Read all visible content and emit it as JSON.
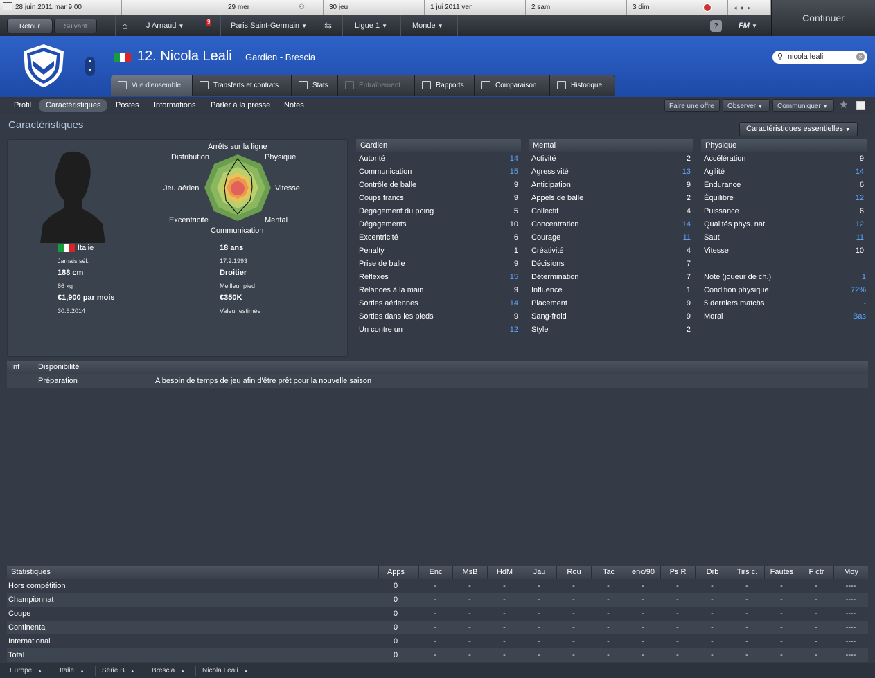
{
  "datebar": {
    "items": [
      {
        "label": "28 juin 2011 mar 9:00"
      },
      {
        "label": "29  mer"
      },
      {
        "label": "30  jeu"
      },
      {
        "label": "1 jui 2011 ven"
      },
      {
        "label": "2  sam"
      },
      {
        "label": "3  dim"
      }
    ]
  },
  "nav": {
    "back": "Retour",
    "forward": "Suivant",
    "manager": "J Arnaud",
    "inbox_count": "9",
    "club": "Paris Saint-Germain",
    "league": "Ligue 1",
    "world": "Monde",
    "help": "?",
    "fm": "FM",
    "continue": "Continuer"
  },
  "player": {
    "number_name": "12. Nicola Leali",
    "position": "Gardien - Brescia",
    "search_value": "nicola leali"
  },
  "tabs": [
    {
      "label": "Vue d'ensemble"
    },
    {
      "label": "Transferts et contrats"
    },
    {
      "label": "Stats"
    },
    {
      "label": "Entraînement"
    },
    {
      "label": "Rapports"
    },
    {
      "label": "Comparaison"
    },
    {
      "label": "Historique"
    }
  ],
  "subtabs": [
    {
      "label": "Profil"
    },
    {
      "label": "Caractéristiques"
    },
    {
      "label": "Postes"
    },
    {
      "label": "Informations"
    },
    {
      "label": "Parler à la presse"
    },
    {
      "label": "Notes"
    }
  ],
  "actions": {
    "offer": "Faire une offre",
    "watch": "Observer",
    "talk": "Communiquer"
  },
  "section": {
    "title": "Caractéristiques",
    "dropdown": "Caractéristiques essentielles"
  },
  "radar": {
    "labels": {
      "top": "Arrêts sur la ligne",
      "tl": "Distribution",
      "tr": "Physique",
      "l": "Jeu aérien",
      "r": "Vitesse",
      "bl": "Excentricité",
      "br": "Mental",
      "b": "Communication"
    }
  },
  "info": {
    "nation": "Italie",
    "caps": "Jamais sél.",
    "height": "188 cm",
    "weight": "86 kg",
    "wage": "€1,900 par mois",
    "contract_end": "30.6.2014",
    "age": "18 ans",
    "dob": "17.2.1993",
    "foot": "Droitier",
    "foot_label": "Meilleur pied",
    "value": "€350K",
    "value_label": "Valeur estimée"
  },
  "gk": {
    "title": "Gardien",
    "rows": [
      {
        "name": "Autorité",
        "value": "14",
        "hl": true
      },
      {
        "name": "Communication",
        "value": "15",
        "hl": true
      },
      {
        "name": "Contrôle de balle",
        "value": "9"
      },
      {
        "name": "Coups francs",
        "value": "9"
      },
      {
        "name": "Dégagement du poing",
        "value": "5"
      },
      {
        "name": "Dégagements",
        "value": "10"
      },
      {
        "name": "Excentricité",
        "value": "6"
      },
      {
        "name": "Penalty",
        "value": "1"
      },
      {
        "name": "Prise de balle",
        "value": "9"
      },
      {
        "name": "Réflexes",
        "value": "15",
        "hl": true
      },
      {
        "name": "Relances à la main",
        "value": "9"
      },
      {
        "name": "Sorties aériennes",
        "value": "14",
        "hl": true
      },
      {
        "name": "Sorties dans les pieds",
        "value": "9"
      },
      {
        "name": "Un contre un",
        "value": "12",
        "hl": true
      }
    ]
  },
  "mental": {
    "title": "Mental",
    "rows": [
      {
        "name": "Activité",
        "value": "2"
      },
      {
        "name": "Agressivité",
        "value": "13",
        "hl": true
      },
      {
        "name": "Anticipation",
        "value": "9"
      },
      {
        "name": "Appels de balle",
        "value": "2"
      },
      {
        "name": "Collectif",
        "value": "4"
      },
      {
        "name": "Concentration",
        "value": "14",
        "hl": true
      },
      {
        "name": "Courage",
        "value": "11",
        "hl": true
      },
      {
        "name": "Créativité",
        "value": "4"
      },
      {
        "name": "Décisions",
        "value": "7"
      },
      {
        "name": "Détermination",
        "value": "7"
      },
      {
        "name": "Influence",
        "value": "1"
      },
      {
        "name": "Placement",
        "value": "9"
      },
      {
        "name": "Sang-froid",
        "value": "9"
      },
      {
        "name": "Style",
        "value": "2"
      }
    ]
  },
  "physical": {
    "title": "Physique",
    "rows": [
      {
        "name": "Accélération",
        "value": "9"
      },
      {
        "name": "Agilité",
        "value": "14",
        "hl": true
      },
      {
        "name": "Endurance",
        "value": "6"
      },
      {
        "name": "Équilibre",
        "value": "12",
        "hl": true
      },
      {
        "name": "Puissance",
        "value": "6"
      },
      {
        "name": "Qualités phys. nat.",
        "value": "12",
        "hl": true
      },
      {
        "name": "Saut",
        "value": "11",
        "hl": true
      },
      {
        "name": "Vitesse",
        "value": "10"
      }
    ],
    "extra": [
      {
        "name": "Note (joueur de ch.)",
        "value": "1",
        "hl": true
      },
      {
        "name": "Condition physique",
        "value": "72%",
        "hl": true
      },
      {
        "name": "5 derniers matchs",
        "value": "-",
        "hl": true
      },
      {
        "name": "Moral",
        "value": "Bas",
        "hl": true
      }
    ]
  },
  "availability": {
    "col1": "Inf",
    "col2": "Disponibilité",
    "row_label": "Préparation",
    "row_text": "A besoin de temps de jeu afin d'être prêt pour la nouvelle saison"
  },
  "stats": {
    "title": "Statistiques",
    "headers": [
      "Apps",
      "Enc",
      "MsB",
      "HdM",
      "Jau",
      "Rou",
      "Tac",
      "enc/90",
      "Ps R",
      "Drb",
      "Tirs c.",
      "Fautes",
      "F ctr",
      "Moy"
    ],
    "rows": [
      {
        "name": "Hors compétition",
        "cells": [
          "0",
          "-",
          "-",
          "-",
          "-",
          "-",
          "-",
          "-",
          "-",
          "-",
          "-",
          "-",
          "-",
          "----"
        ]
      },
      {
        "name": "Championnat",
        "cells": [
          "0",
          "-",
          "-",
          "-",
          "-",
          "-",
          "-",
          "-",
          "-",
          "-",
          "-",
          "-",
          "-",
          "----"
        ]
      },
      {
        "name": "Coupe",
        "cells": [
          "0",
          "-",
          "-",
          "-",
          "-",
          "-",
          "-",
          "-",
          "-",
          "-",
          "-",
          "-",
          "-",
          "----"
        ]
      },
      {
        "name": "Continental",
        "cells": [
          "0",
          "-",
          "-",
          "-",
          "-",
          "-",
          "-",
          "-",
          "-",
          "-",
          "-",
          "-",
          "-",
          "----"
        ]
      },
      {
        "name": "International",
        "cells": [
          "0",
          "-",
          "-",
          "-",
          "-",
          "-",
          "-",
          "-",
          "-",
          "-",
          "-",
          "-",
          "-",
          "----"
        ]
      },
      {
        "name": "Total",
        "cells": [
          "0",
          "-",
          "-",
          "-",
          "-",
          "-",
          "-",
          "-",
          "-",
          "-",
          "-",
          "-",
          "-",
          "----"
        ]
      }
    ]
  },
  "breadcrumbs": [
    {
      "label": "Europe"
    },
    {
      "label": "Italie"
    },
    {
      "label": "Série B"
    },
    {
      "label": "Brescia"
    },
    {
      "label": "Nicola Leali"
    }
  ],
  "colors": {
    "header_blue": "#2a5cc4",
    "highlight": "#5ea7ff",
    "background": "#343b46"
  }
}
